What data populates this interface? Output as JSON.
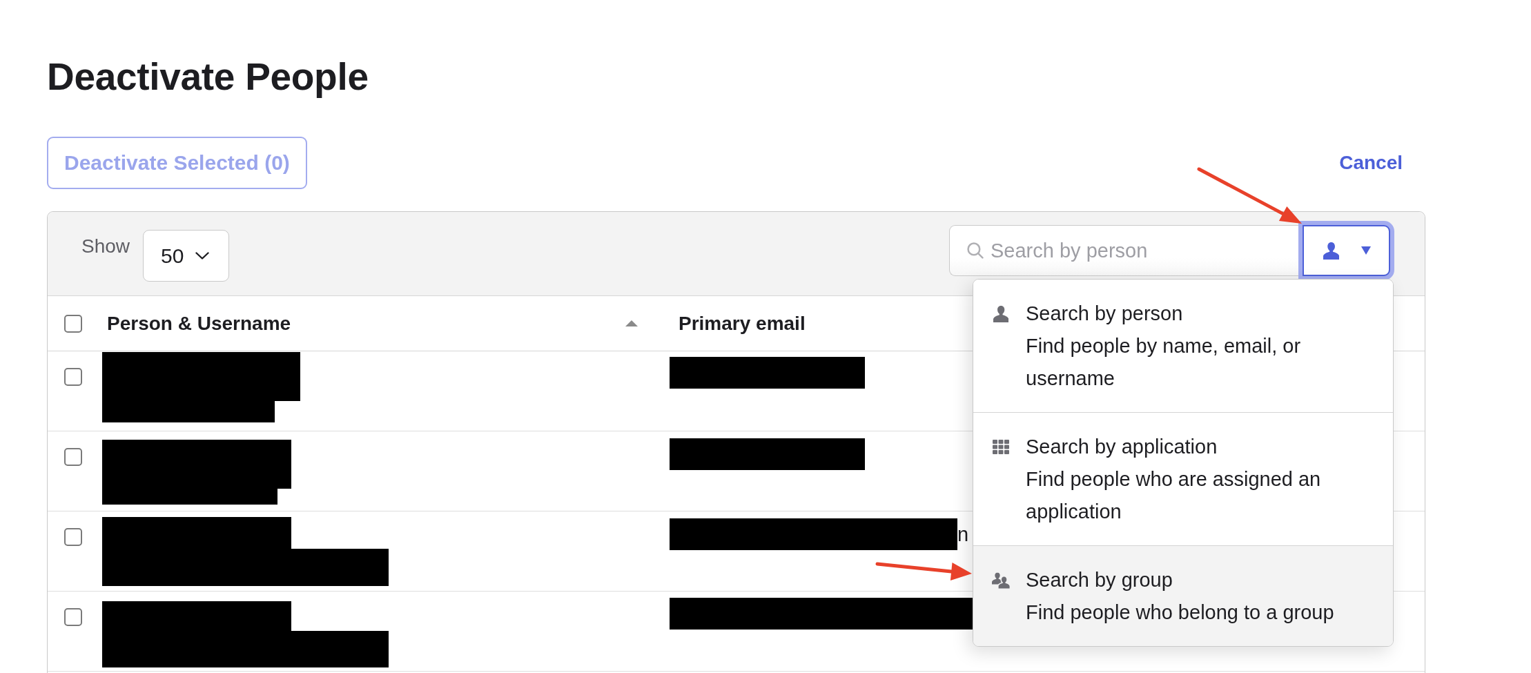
{
  "page_title": "Deactivate People",
  "actions": {
    "deactivate_button": {
      "label": "Deactivate Selected (0)",
      "disabled": true
    },
    "cancel_link": {
      "label": "Cancel"
    }
  },
  "toolbar": {
    "show": {
      "label": "Show",
      "value": "50"
    },
    "search": {
      "placeholder": "Search by person"
    },
    "filter_button": {
      "kind": "person",
      "expanded": true,
      "menu": [
        {
          "kind": "person",
          "title": "Search by person",
          "description": "Find people by name, email, or username",
          "highlighted": false
        },
        {
          "kind": "application",
          "title": "Search by application",
          "description": "Find people who are assigned an application",
          "highlighted": false
        },
        {
          "kind": "group",
          "title": "Search by group",
          "description": "Find people who belong to a group",
          "highlighted": true
        }
      ]
    }
  },
  "table": {
    "select_all": {
      "checked": false
    },
    "columns": [
      {
        "label": "Person & Username",
        "sorted": true
      },
      {
        "label": "Primary email",
        "sorted": false
      }
    ],
    "rows": [
      {
        "checked": false,
        "redacted": true
      },
      {
        "checked": false,
        "redacted": true
      },
      {
        "checked": false,
        "redacted": true,
        "email_tail": "n"
      },
      {
        "checked": false,
        "redacted": true
      }
    ]
  }
}
